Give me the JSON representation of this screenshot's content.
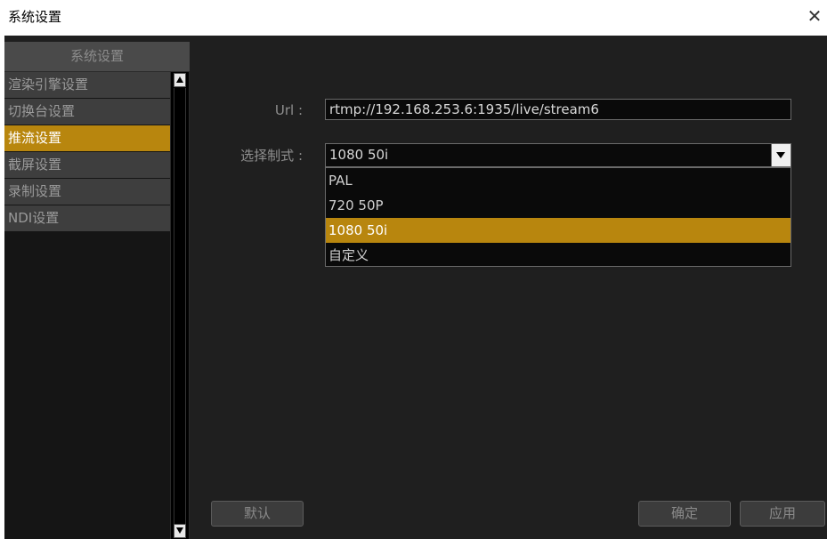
{
  "window": {
    "title": "系统设置",
    "close_icon": "close-icon"
  },
  "sidebar": {
    "header": "系统设置",
    "items": [
      {
        "label": "渲染引擎设置"
      },
      {
        "label": "切换台设置"
      },
      {
        "label": "推流设置",
        "active": true
      },
      {
        "label": "截屏设置"
      },
      {
        "label": "录制设置"
      },
      {
        "label": "NDI设置"
      }
    ]
  },
  "form": {
    "url_label": "Url :",
    "url_value": "rtmp://192.168.253.6:1935/live/stream6",
    "format_label": "选择制式 :",
    "format_value": "1080 50i",
    "format_options": [
      "PAL",
      "720 50P",
      "1080 50i",
      "自定义"
    ],
    "format_selected_index": 2
  },
  "buttons": {
    "default": "默认",
    "ok": "确定",
    "apply": "应用"
  },
  "colors": {
    "accent": "#b8860e",
    "panel": "#1f1f1f",
    "sidebar_item": "#3e3e3e"
  }
}
